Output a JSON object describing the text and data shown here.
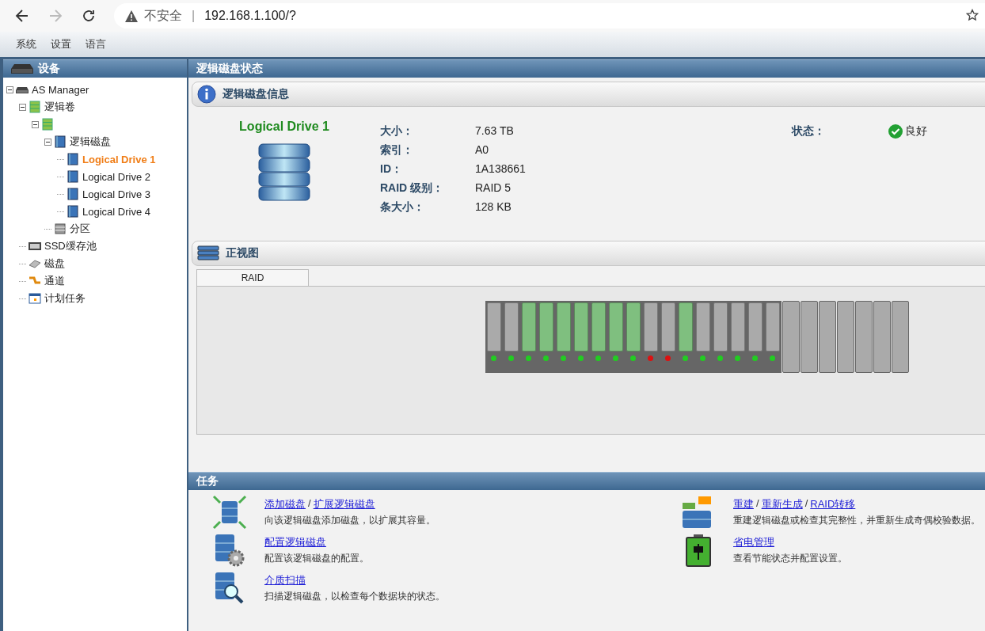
{
  "browser": {
    "back_disabled": false,
    "forward_disabled": true,
    "security": "不安全",
    "separator": "|",
    "url": "192.168.1.100/?"
  },
  "menu": [
    "系统",
    "设置",
    "语言"
  ],
  "sidebar": {
    "title": "设备",
    "tree": [
      {
        "label": "AS Manager",
        "selected": false,
        "expanded": true,
        "children": [
          {
            "label": "逻辑卷",
            "selected": false,
            "expanded": true,
            "children": [
              {
                "expanded": true,
                "children": [
                  {
                    "label": "逻辑磁盘",
                    "selected": false,
                    "expanded": true,
                    "children": [
                      {
                        "label": "Logical Drive 1",
                        "selected": true
                      },
                      {
                        "label": "Logical Drive 2",
                        "selected": false
                      },
                      {
                        "label": "Logical Drive 3",
                        "selected": false
                      },
                      {
                        "label": "Logical Drive 4",
                        "selected": false
                      }
                    ]
                  },
                  {
                    "label": "分区",
                    "selected": false
                  }
                ]
              }
            ]
          },
          {
            "label": "SSD缓存池",
            "selected": false
          },
          {
            "label": "磁盘",
            "selected": false
          },
          {
            "label": "通道",
            "selected": false
          },
          {
            "label": "计划任务",
            "selected": false
          }
        ]
      }
    ]
  },
  "main": {
    "title": "逻辑磁盘状态",
    "info": {
      "title": "逻辑磁盘信息",
      "drive_name": "Logical Drive 1",
      "fields": [
        {
          "label": "大小：",
          "value": "7.63 TB"
        },
        {
          "label": "索引：",
          "value": "A0"
        },
        {
          "label": "ID：",
          "value": "1A138661"
        },
        {
          "label": "RAID 级别：",
          "value": "RAID 5"
        },
        {
          "label": "条大小：",
          "value": "128 KB"
        }
      ],
      "status": {
        "label": "状态：",
        "value": "良好",
        "ok": true
      }
    },
    "front_view": {
      "title": "正视图",
      "tabs": [
        {
          "label": "RAID",
          "selected": true
        }
      ],
      "bays": [
        {
          "kind": "disk",
          "member": false,
          "color": "#22cc22"
        },
        {
          "kind": "disk",
          "member": false,
          "color": "#22cc22"
        },
        {
          "kind": "disk",
          "member": true,
          "color": "#22cc22"
        },
        {
          "kind": "disk",
          "member": true,
          "color": "#22cc22"
        },
        {
          "kind": "disk",
          "member": true,
          "color": "#22cc22"
        },
        {
          "kind": "disk",
          "member": true,
          "color": "#22cc22"
        },
        {
          "kind": "disk",
          "member": true,
          "color": "#22cc22"
        },
        {
          "kind": "disk",
          "member": true,
          "color": "#22cc22"
        },
        {
          "kind": "disk",
          "member": true,
          "color": "#22cc22"
        },
        {
          "kind": "disk",
          "member": false,
          "color": "#dd1111"
        },
        {
          "kind": "disk",
          "member": false,
          "color": "#dd1111"
        },
        {
          "kind": "disk",
          "member": true,
          "color": "#22cc22"
        },
        {
          "kind": "disk",
          "member": false,
          "color": "#22cc22"
        },
        {
          "kind": "disk",
          "member": false,
          "color": "#22cc22"
        },
        {
          "kind": "disk",
          "member": false,
          "color": "#22cc22"
        },
        {
          "kind": "disk",
          "member": false,
          "color": "#22cc22"
        },
        {
          "kind": "disk",
          "member": false,
          "color": "#22cc22"
        },
        {
          "kind": "empty"
        },
        {
          "kind": "empty"
        },
        {
          "kind": "empty"
        },
        {
          "kind": "empty"
        },
        {
          "kind": "empty"
        },
        {
          "kind": "empty"
        },
        {
          "kind": "empty"
        }
      ]
    }
  },
  "tasks": {
    "title": "任务",
    "columns": [
      [
        {
          "links": [
            "添加磁盘",
            "扩展逻辑磁盘"
          ],
          "separator": "/",
          "description": "向该逻辑磁盘添加磁盘，以扩展其容量。"
        },
        {
          "links": [
            "配置逻辑磁盘"
          ],
          "description": "配置该逻辑磁盘的配置。"
        },
        {
          "links": [
            "介质扫描"
          ],
          "description": "扫描逻辑磁盘，以检查每个数据块的状态。"
        }
      ],
      [
        {
          "links": [
            "重建",
            "重新生成",
            "RAID转移"
          ],
          "separator": "/",
          "description": "重建逻辑磁盘或检查其完整性，并重新生成奇偶校验数据。"
        },
        {
          "links": [
            "省电管理"
          ],
          "description": "查看节能状态并配置设置。"
        }
      ]
    ]
  }
}
